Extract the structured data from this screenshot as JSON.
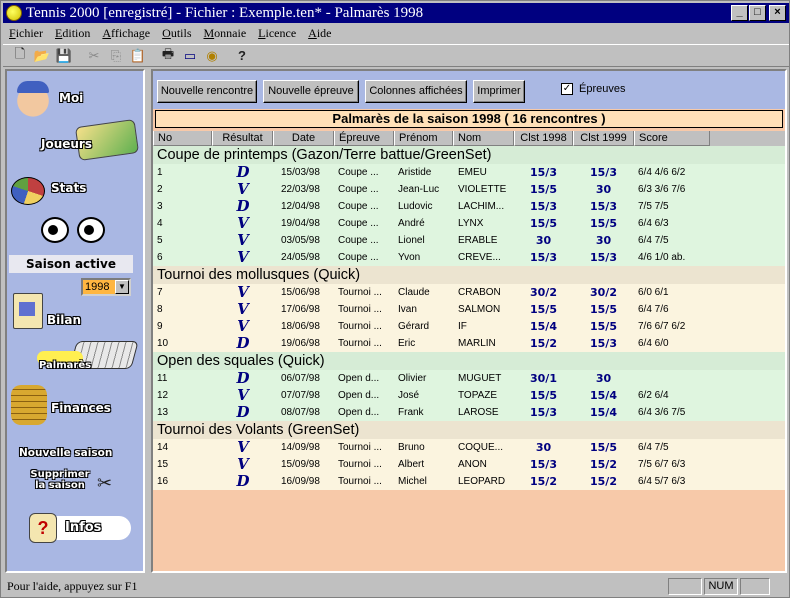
{
  "window": {
    "title": "Tennis 2000 [enregistré] - Fichier : Exemple.ten* - Palmarès 1998",
    "buttons": {
      "minimize": "_",
      "maximize": "□",
      "close": "×"
    }
  },
  "menu": [
    "Fichier",
    "Edition",
    "Affichage",
    "Outils",
    "Monnaie",
    "Licence",
    "Aide"
  ],
  "toolbar": {
    "icons": [
      "new-icon",
      "open-folder-icon",
      "save-icon",
      "cut-icon",
      "copy-icon",
      "paste-icon",
      "print-icon",
      "card-icon",
      "coin-icon",
      "help-icon"
    ],
    "glyphs": [
      "🗋",
      "📂",
      "💾",
      "✂",
      "⎘",
      "📋",
      "🖶",
      "▭",
      "◉",
      "?"
    ]
  },
  "sidebar": {
    "items": [
      {
        "label": "Moi"
      },
      {
        "label": "Joueurs"
      },
      {
        "label": "Stats"
      },
      {
        "label": "Bilan"
      },
      {
        "label": "Palmarès"
      },
      {
        "label": "Finances"
      },
      {
        "label": "Nouvelle saison"
      },
      {
        "label": "Supprimer la saison"
      },
      {
        "label": "Infos"
      }
    ],
    "saison_active_label": "Saison active",
    "year": "1998"
  },
  "buttons": {
    "nouvelle_rencontre": "Nouvelle rencontre",
    "nouvelle_epreuve": "Nouvelle épreuve",
    "colonnes_affichees": "Colonnes affichées",
    "imprimer": "Imprimer"
  },
  "epreuves_checkbox": {
    "label": "Épreuves",
    "checked": true,
    "mark": "✓"
  },
  "content_title": "Palmarès de la saison 1998  ( 16 rencontres )",
  "columns": [
    "No",
    "Résultat",
    "Date",
    "Épreuve",
    "Prénom",
    "Nom",
    "Clst 1998",
    "Clst 1999",
    "Score"
  ],
  "colors": {
    "group_a_bg": "#dff5df",
    "group_a_header": "#d6ecd6",
    "group_b_bg": "#fbf4df",
    "group_b_header": "#ece4d0",
    "main_bg": "#f7c9a9",
    "accent": "#000080"
  },
  "groups": [
    {
      "title": "Coupe de printemps  (Gazon/Terre battue/GreenSet)",
      "rows": [
        {
          "no": "1",
          "res": "D",
          "date": "15/03/98",
          "ep": "Coupe ...",
          "prenom": "Aristide",
          "nom": "EMEU",
          "c98": "15/3",
          "c99": "15/3",
          "score": "6/4 4/6 6/2"
        },
        {
          "no": "2",
          "res": "V",
          "date": "22/03/98",
          "ep": "Coupe ...",
          "prenom": "Jean-Luc",
          "nom": "VIOLETTE",
          "c98": "15/5",
          "c99": "30",
          "score": "6/3 3/6 7/6"
        },
        {
          "no": "3",
          "res": "D",
          "date": "12/04/98",
          "ep": "Coupe ...",
          "prenom": "Ludovic",
          "nom": "LACHIM...",
          "c98": "15/3",
          "c99": "15/3",
          "score": "7/5 7/5"
        },
        {
          "no": "4",
          "res": "V",
          "date": "19/04/98",
          "ep": "Coupe ...",
          "prenom": "André",
          "nom": "LYNX",
          "c98": "15/5",
          "c99": "15/5",
          "score": "6/4 6/3"
        },
        {
          "no": "5",
          "res": "V",
          "date": "03/05/98",
          "ep": "Coupe ...",
          "prenom": "Lionel",
          "nom": "ERABLE",
          "c98": "30",
          "c99": "30",
          "score": "6/4 7/5"
        },
        {
          "no": "6",
          "res": "V",
          "date": "24/05/98",
          "ep": "Coupe ...",
          "prenom": "Yvon",
          "nom": "CREVE...",
          "c98": "15/3",
          "c99": "15/3",
          "score": "4/6 1/0 ab."
        }
      ]
    },
    {
      "title": "Tournoi des mollusques  (Quick)",
      "rows": [
        {
          "no": "7",
          "res": "V",
          "date": "15/06/98",
          "ep": "Tournoi ...",
          "prenom": "Claude",
          "nom": "CRABON",
          "c98": "30/2",
          "c99": "30/2",
          "score": "6/0 6/1"
        },
        {
          "no": "8",
          "res": "V",
          "date": "17/06/98",
          "ep": "Tournoi ...",
          "prenom": "Ivan",
          "nom": "SALMON",
          "c98": "15/5",
          "c99": "15/5",
          "score": "6/4 7/6"
        },
        {
          "no": "9",
          "res": "V",
          "date": "18/06/98",
          "ep": "Tournoi ...",
          "prenom": "Gérard",
          "nom": "IF",
          "c98": "15/4",
          "c99": "15/5",
          "score": "7/6 6/7 6/2"
        },
        {
          "no": "10",
          "res": "D",
          "date": "19/06/98",
          "ep": "Tournoi ...",
          "prenom": "Eric",
          "nom": "MARLIN",
          "c98": "15/2",
          "c99": "15/3",
          "score": "6/4 6/0"
        }
      ]
    },
    {
      "title": "Open des squales  (Quick)",
      "rows": [
        {
          "no": "11",
          "res": "D",
          "date": "06/07/98",
          "ep": "Open d...",
          "prenom": "Olivier",
          "nom": "MUGUET",
          "c98": "30/1",
          "c99": "30",
          "score": ""
        },
        {
          "no": "12",
          "res": "V",
          "date": "07/07/98",
          "ep": "Open d...",
          "prenom": "José",
          "nom": "TOPAZE",
          "c98": "15/5",
          "c99": "15/4",
          "score": "6/2 6/4"
        },
        {
          "no": "13",
          "res": "D",
          "date": "08/07/98",
          "ep": "Open d...",
          "prenom": "Frank",
          "nom": "LAROSE",
          "c98": "15/3",
          "c99": "15/4",
          "score": "6/4 3/6 7/5"
        }
      ]
    },
    {
      "title": "Tournoi des Volants  (GreenSet)",
      "rows": [
        {
          "no": "14",
          "res": "V",
          "date": "14/09/98",
          "ep": "Tournoi ...",
          "prenom": "Bruno",
          "nom": "COQUE...",
          "c98": "30",
          "c99": "15/5",
          "score": "6/4 7/5"
        },
        {
          "no": "15",
          "res": "V",
          "date": "15/09/98",
          "ep": "Tournoi ...",
          "prenom": "Albert",
          "nom": "ANON",
          "c98": "15/3",
          "c99": "15/2",
          "score": "7/5 6/7 6/3"
        },
        {
          "no": "16",
          "res": "D",
          "date": "16/09/98",
          "ep": "Tournoi ...",
          "prenom": "Michel",
          "nom": "LEOPARD",
          "c98": "15/2",
          "c99": "15/2",
          "score": "6/4 5/7 6/3"
        }
      ]
    }
  ],
  "status": {
    "help": "Pour l'aide, appuyez sur F1",
    "num": "NUM"
  }
}
